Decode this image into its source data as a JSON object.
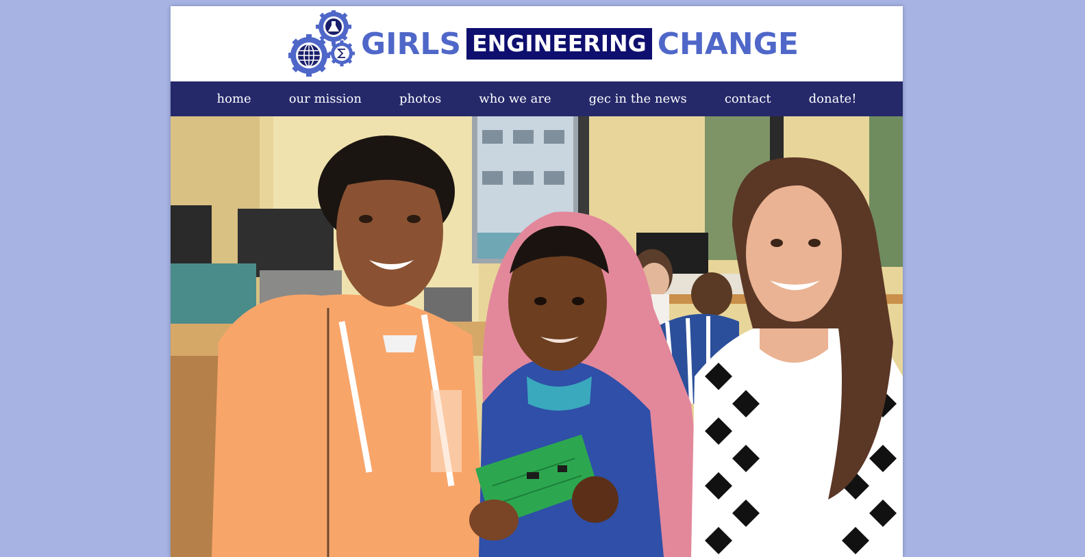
{
  "brand": {
    "word1": "GIRLS",
    "word2": "ENGINEERING",
    "word3": "CHANGE",
    "gear_icons": [
      "flask-icon",
      "globe-icon",
      "sigma-icon"
    ]
  },
  "nav": {
    "items": [
      {
        "label": "home"
      },
      {
        "label": "our mission"
      },
      {
        "label": "photos"
      },
      {
        "label": "who we are"
      },
      {
        "label": "gec in the news"
      },
      {
        "label": "contact"
      },
      {
        "label": "donate!"
      }
    ]
  },
  "colors": {
    "page_background": "#a7b4e3",
    "nav_background": "#25296a",
    "brand_blue": "#4f67c8",
    "brand_navy": "#0e0f6e"
  }
}
